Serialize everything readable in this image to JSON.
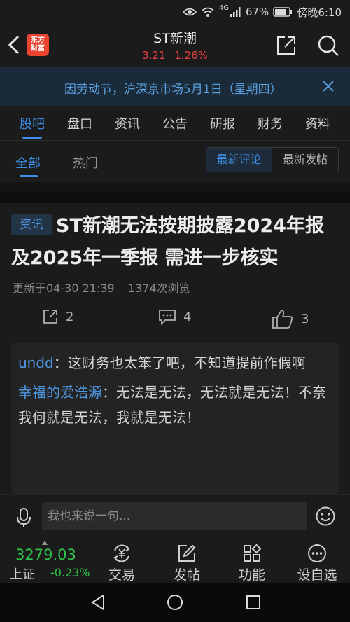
{
  "status_bar": {
    "network": "4G",
    "battery": "67%",
    "time": "傍晚6:10"
  },
  "header": {
    "logo_text": "东方财富",
    "stock_name": "ST新潮",
    "price": "3.21",
    "change_pct": "1.26%"
  },
  "notice": {
    "text": "因劳动节，沪深京市场5月1日（星期四）"
  },
  "main_tabs": [
    "股吧",
    "盘口",
    "资讯",
    "公告",
    "研报",
    "财务",
    "资料"
  ],
  "sub_tabs": {
    "all": "全部",
    "hot": "热门",
    "latest_comment": "最新评论",
    "latest_post": "最新发帖"
  },
  "post": {
    "tag": "资讯",
    "title": "ST新潮无法按期披露2024年报及2025年一季报 需进一步核实",
    "updated": "更新于04-30 21:39",
    "views": "1374次浏览",
    "shares": "2",
    "comments": "4",
    "likes": "3"
  },
  "comments": [
    {
      "user": "undd",
      "text": "：这财务也太笨了吧，不知道提前作假啊"
    },
    {
      "user": "幸福的爱浩源",
      "text": "：无法是无法，无法就是无法！不奈我何就是无法，我就是无法！"
    }
  ],
  "input": {
    "placeholder": "我也来说一句..."
  },
  "toolbar": {
    "index_value": "3279.03",
    "index_name": "上证",
    "index_change": "-0.23%",
    "trade": "交易",
    "post": "发帖",
    "functions": "功能",
    "watchlist": "设自选"
  },
  "colors": {
    "accent": "#3d8ee8",
    "up": "#e94040",
    "down": "#2fc24a",
    "background": "#1b1b1b"
  }
}
